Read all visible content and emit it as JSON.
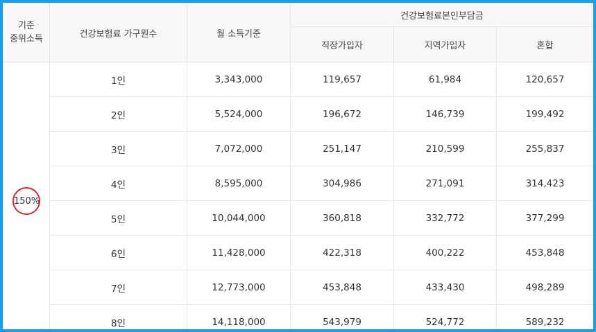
{
  "header": {
    "col_left_line1": "기준",
    "col_left_line2": "중위소득",
    "col_household": "건강보험료 가구원수",
    "col_income": "월 소득기준",
    "col_burden": "건강보험료본인부담금",
    "sub_employee": "직장가입자",
    "sub_regional": "지역가입자",
    "sub_mixed": "혼합"
  },
  "group_label": "150%",
  "rows": [
    {
      "household": "1인",
      "income": "3,343,000",
      "employee": "119,657",
      "regional": "61,984",
      "mixed": "120,657"
    },
    {
      "household": "2인",
      "income": "5,524,000",
      "employee": "196,672",
      "regional": "146,739",
      "mixed": "199,492"
    },
    {
      "household": "3인",
      "income": "7,072,000",
      "employee": "251,147",
      "regional": "210,599",
      "mixed": "255,837"
    },
    {
      "household": "4인",
      "income": "8,595,000",
      "employee": "304,986",
      "regional": "271,091",
      "mixed": "314,423"
    },
    {
      "household": "5인",
      "income": "10,044,000",
      "employee": "360,818",
      "regional": "332,772",
      "mixed": "377,299"
    },
    {
      "household": "6인",
      "income": "11,428,000",
      "employee": "422,318",
      "regional": "400,222",
      "mixed": "453,848"
    },
    {
      "household": "7인",
      "income": "12,773,000",
      "employee": "453,848",
      "regional": "433,430",
      "mixed": "498,289"
    },
    {
      "household": "8인",
      "income": "14,118,000",
      "employee": "543,979",
      "regional": "524,772",
      "mixed": "589,232"
    }
  ],
  "colors": {
    "frame_border": "#1a9fe6",
    "header_bg": "#f7f7f7",
    "grid_line": "#e6e6e6",
    "highlight_circle": "#d9252b"
  }
}
